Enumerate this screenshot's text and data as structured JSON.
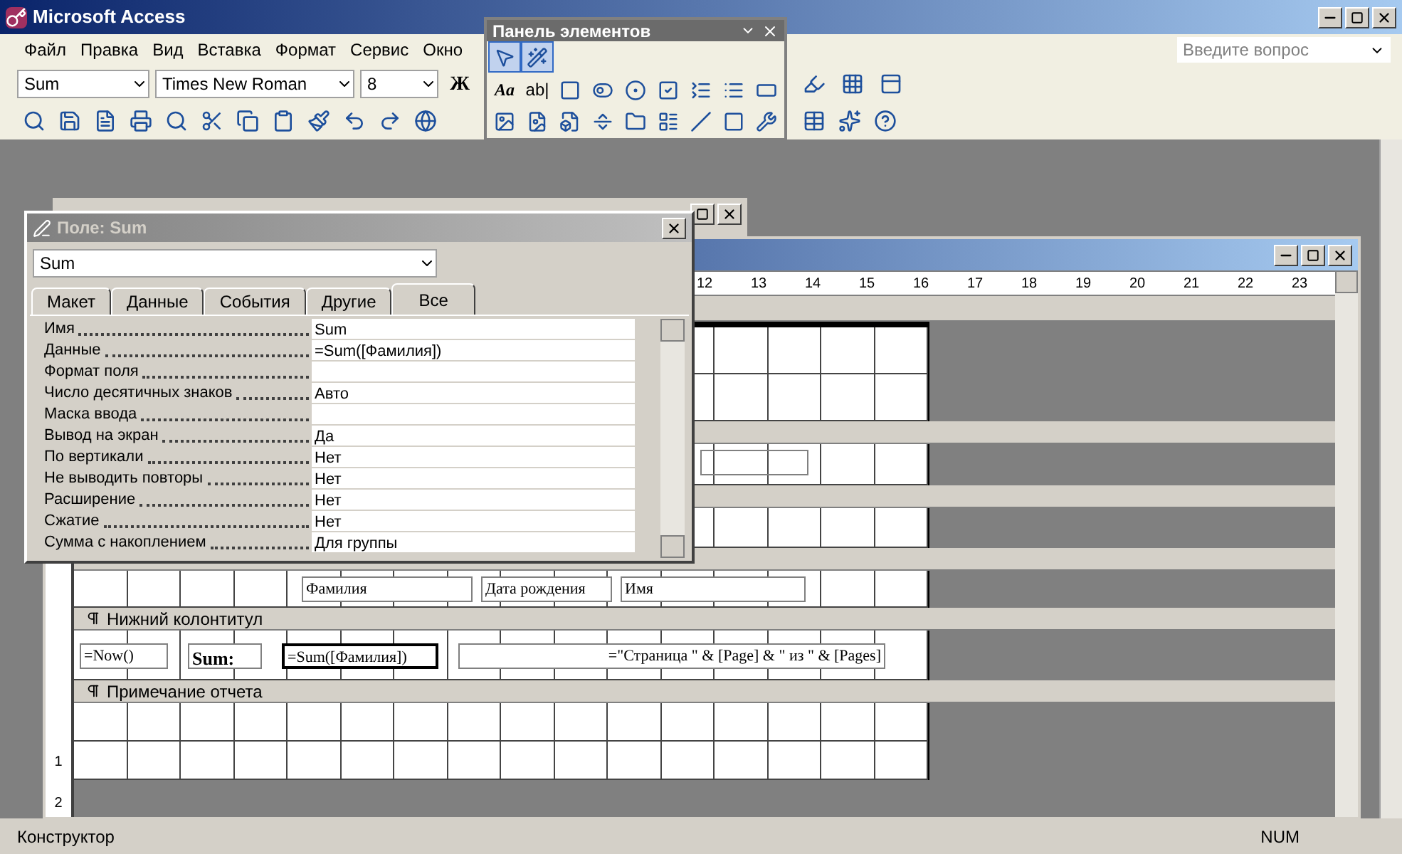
{
  "app_title": "Microsoft Access",
  "menu": [
    "Файл",
    "Правка",
    "Вид",
    "Вставка",
    "Формат",
    "Сервис",
    "Окно"
  ],
  "help_box": {
    "placeholder": "Введите вопрос"
  },
  "format_toolbar": {
    "object": "Sum",
    "font": "Times New Roman",
    "size": "8",
    "bold": "Ж"
  },
  "toolbox": {
    "title": "Панель элементов",
    "rows": [
      [
        {
          "kind": "select",
          "selected": true
        },
        {
          "kind": "wizard",
          "selected": true
        }
      ],
      [
        {
          "kind": "label",
          "text": "Aa",
          "selected": false
        },
        {
          "kind": "textbox",
          "text": "ab|",
          "selected": false
        },
        {
          "kind": "frame",
          "selected": false
        },
        {
          "kind": "toggle",
          "selected": false
        },
        {
          "kind": "radio",
          "selected": false
        },
        {
          "kind": "checkbox",
          "selected": false
        },
        {
          "kind": "combo",
          "selected": false
        },
        {
          "kind": "list",
          "selected": false
        },
        {
          "kind": "button",
          "selected": false
        }
      ],
      [
        {
          "kind": "image",
          "selected": false
        },
        {
          "kind": "object",
          "selected": false
        },
        {
          "kind": "bound-object",
          "selected": false
        },
        {
          "kind": "page-break",
          "selected": false
        },
        {
          "kind": "tab",
          "selected": false
        },
        {
          "kind": "subform",
          "selected": false
        },
        {
          "kind": "line",
          "selected": false
        },
        {
          "kind": "rectangle",
          "selected": false
        },
        {
          "kind": "more",
          "selected": false
        }
      ]
    ]
  },
  "properties": {
    "title": "Поле: Sum",
    "object": "Sum",
    "tabs": [
      {
        "label": "Макет",
        "selected": false
      },
      {
        "label": "Данные",
        "selected": false
      },
      {
        "label": "События",
        "selected": false
      },
      {
        "label": "Другие",
        "selected": false
      },
      {
        "label": "Все",
        "selected": true
      }
    ],
    "rows": [
      {
        "name": "Имя",
        "value": "Sum"
      },
      {
        "name": "Данные",
        "value": "=Sum([Фамилия])"
      },
      {
        "name": "Формат поля",
        "value": ""
      },
      {
        "name": "Число десятичных знаков",
        "value": "Авто"
      },
      {
        "name": "Маска ввода",
        "value": ""
      },
      {
        "name": "Вывод на экран",
        "value": "Да"
      },
      {
        "name": "По вертикали",
        "value": "Нет"
      },
      {
        "name": "Не выводить повторы",
        "value": "Нет"
      },
      {
        "name": "Расширение",
        "value": "Нет"
      },
      {
        "name": "Сжатие",
        "value": "Нет"
      },
      {
        "name": "Сумма с накоплением",
        "value": "Для группы"
      }
    ]
  },
  "report": {
    "ruler": [
      "12",
      "13",
      "14",
      "15",
      "16",
      "17",
      "18",
      "19",
      "20",
      "21",
      "22",
      "23"
    ],
    "vruler": [
      "1",
      "2"
    ],
    "detail_fields": [
      "Фамилия",
      "Дата рождения",
      "Имя"
    ],
    "footer_title": "Нижний колонтитул",
    "footer_fields": [
      {
        "text": "=Now()",
        "bold": false,
        "selected": false
      },
      {
        "text": "Sum:",
        "bold": true,
        "selected": false
      },
      {
        "text": "=Sum([Фамилия])",
        "bold": false,
        "selected": true
      },
      {
        "text": "=\"Страница \" & [Page] & \" из \" & [Pages]",
        "bold": false,
        "selected": false
      }
    ],
    "summary_title": "Примечание отчета"
  },
  "status_bar": {
    "mode": "Конструктор",
    "num": "NUM"
  }
}
